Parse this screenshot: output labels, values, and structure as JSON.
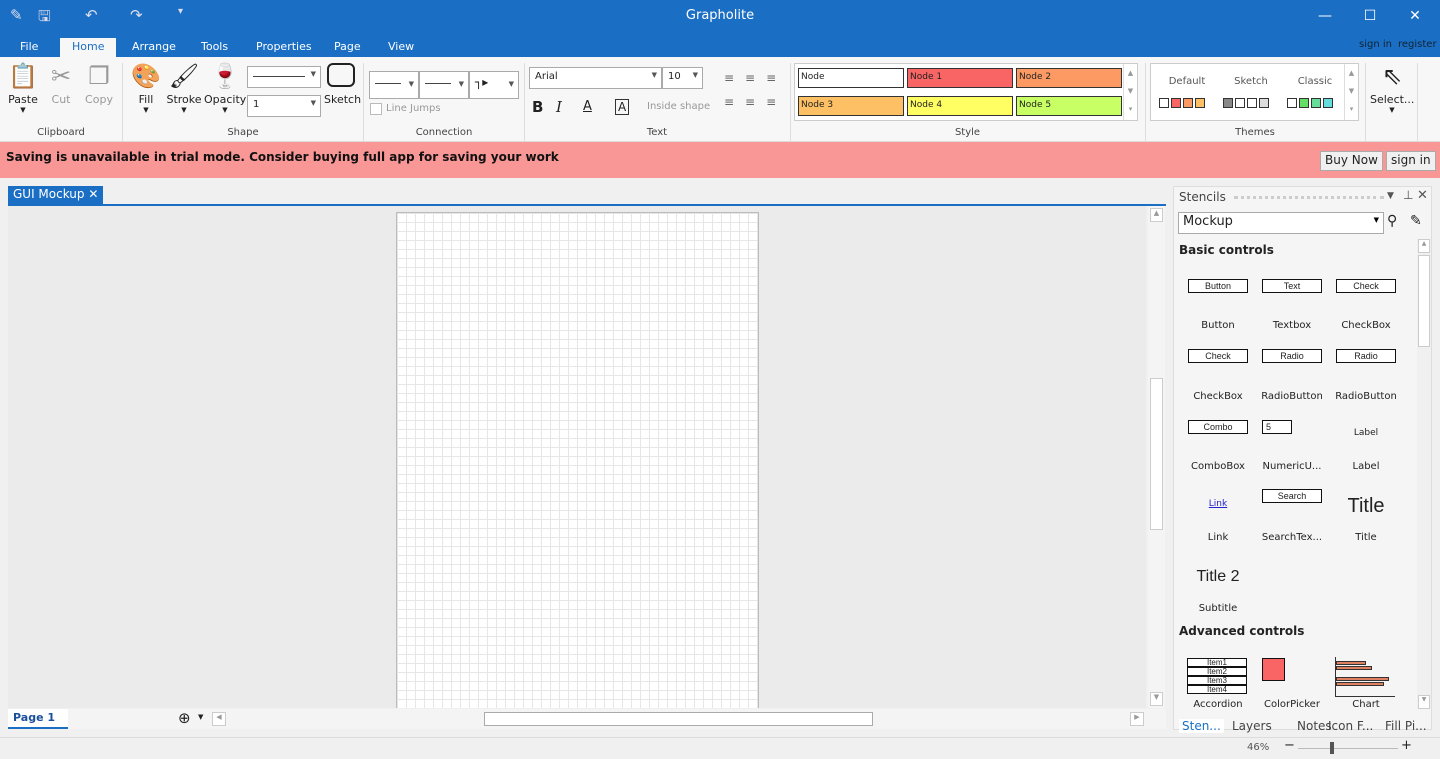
{
  "app": {
    "title": "Grapholite"
  },
  "ribbon_tabs": [
    "File",
    "Home",
    "Arrange",
    "Tools",
    "Properties",
    "Page",
    "View"
  ],
  "account": {
    "sign_in": "sign in",
    "register": "register"
  },
  "clipboard": {
    "group": "Clipboard",
    "paste": "Paste",
    "cut": "Cut",
    "copy": "Copy"
  },
  "shape": {
    "group": "Shape",
    "fill": "Fill",
    "stroke": "Stroke",
    "opacity": "Opacity",
    "stroke_width": "1",
    "sketch": "Sketch"
  },
  "connection": {
    "group": "Connection",
    "line_jumps": "Line Jumps"
  },
  "text": {
    "group": "Text",
    "font": "Arial",
    "size": "10",
    "bold": "B",
    "italic": "I",
    "font_color": "A",
    "highlight": "A",
    "inside_shape": "Inside shape"
  },
  "style": {
    "group": "Style",
    "nodes": [
      {
        "label": "Node",
        "color": "#ffffff"
      },
      {
        "label": "Node 1",
        "color": "#f96464"
      },
      {
        "label": "Node 2",
        "color": "#fd9a64"
      },
      {
        "label": "Node 3",
        "color": "#fdc064"
      },
      {
        "label": "Node 4",
        "color": "#ffff64"
      },
      {
        "label": "Node 5",
        "color": "#c8ff64"
      }
    ]
  },
  "themes": {
    "group": "Themes",
    "items": [
      {
        "label": "Default",
        "swatches": [
          "#ffffff",
          "#f96464",
          "#fd9a64",
          "#fdc064"
        ]
      },
      {
        "label": "Sketch",
        "swatches": [
          "#888888",
          "#ffffff",
          "#ffffff",
          "#dddddd"
        ]
      },
      {
        "label": "Classic",
        "swatches": [
          "#ffffff",
          "#66dd66",
          "#66dd99",
          "#66dddd"
        ]
      }
    ]
  },
  "select": {
    "label": "Select..."
  },
  "trial": {
    "message": "Saving is unavailable in trial mode. Consider buying full app for saving your work",
    "buy": "Buy Now",
    "sign_in": "sign in"
  },
  "document": {
    "tab": "GUI Mockup",
    "page_tab": "Page 1"
  },
  "stencils": {
    "title": "Stencils",
    "library": "Mockup",
    "basic_title": "Basic controls",
    "basic": [
      {
        "preview": "Button",
        "label": "Button"
      },
      {
        "preview": "Text",
        "label": "Textbox"
      },
      {
        "preview": "Check",
        "label": "CheckBox"
      },
      {
        "preview": "Check",
        "label": "CheckBox"
      },
      {
        "preview": "Radio",
        "label": "RadioButton"
      },
      {
        "preview": "Radio",
        "label": "RadioButton"
      },
      {
        "preview": "Combo",
        "label": "ComboBox"
      },
      {
        "preview": "5",
        "label": "NumericU..."
      },
      {
        "preview": "Label",
        "label": "Label"
      },
      {
        "preview": "Link",
        "label": "Link"
      },
      {
        "preview": "Search",
        "label": "SearchTex..."
      },
      {
        "preview": "Title",
        "label": "Title"
      },
      {
        "preview": "Title 2",
        "label": "Subtitle"
      }
    ],
    "advanced_title": "Advanced controls",
    "advanced": [
      {
        "label": "Accordion",
        "items": [
          "Item1",
          "Item2",
          "Item3",
          "Item4"
        ]
      },
      {
        "label": "ColorPicker"
      },
      {
        "label": "Chart"
      }
    ],
    "tabs": [
      "Sten...",
      "Layers",
      "Notes",
      "Icon F...",
      "Fill Pi..."
    ]
  },
  "status": {
    "zoom": "46%",
    "zoom_level": 46
  }
}
